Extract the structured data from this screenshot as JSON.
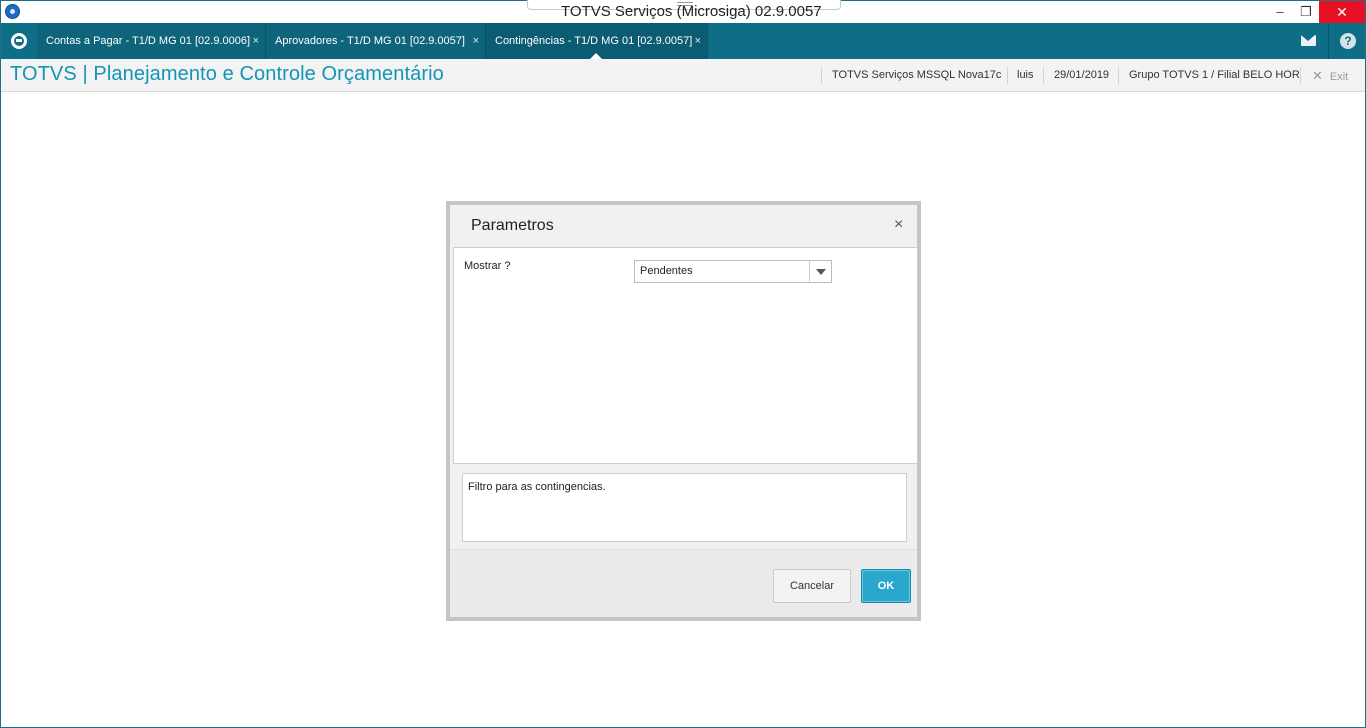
{
  "window": {
    "title": "TOTVS Serviços (Microsiga) 02.9.0057",
    "controls": {
      "minimize": "–",
      "restore": "❐",
      "close": "✕"
    }
  },
  "tabs": [
    {
      "label": "Contas a Pagar - T1/D MG 01  [02.9.0006]",
      "close": "×"
    },
    {
      "label": "Aprovadores - T1/D MG 01  [02.9.0057]",
      "close": "×"
    },
    {
      "label": "Contingências - T1/D MG 01  [02.9.0057]",
      "close": "×",
      "active": true
    }
  ],
  "toolbar_icons": {
    "mail": "mail-icon",
    "help": "?"
  },
  "header": {
    "app_title": "TOTVS | Planejamento e Controle Orçamentário",
    "environment": "TOTVS Serviços MSSQL Nova17c",
    "user": "luis",
    "date": "29/01/2019",
    "company": "Grupo TOTVS 1 / Filial BELO HOR",
    "exit_icon": "✕",
    "exit_label": "Exit"
  },
  "dialog": {
    "title": "Parametros",
    "close": "×",
    "field_label": "Mostrar ?",
    "field_value": "Pendentes",
    "help_text": "Filtro para as contingencias.",
    "cancel_label": "Cancelar",
    "ok_label": "OK"
  },
  "colors": {
    "tabbar": "#0e6e88",
    "title_accent": "#1494b4",
    "ok_button": "#2aa7cc",
    "close_button": "#e81123"
  }
}
